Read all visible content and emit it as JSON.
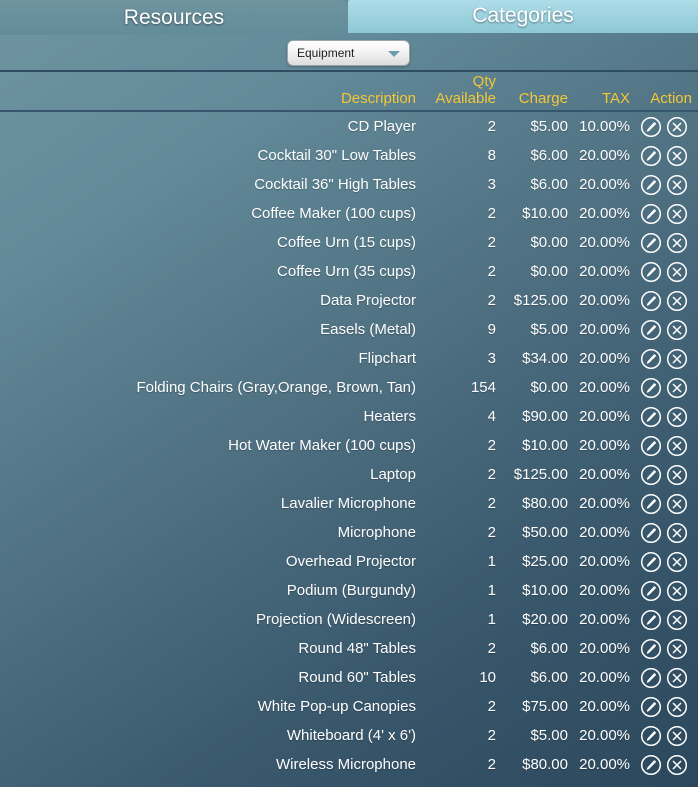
{
  "tabs": [
    {
      "label": "Resources",
      "active": true
    },
    {
      "label": "Categories",
      "active": false
    }
  ],
  "toolbar": {
    "category_select": {
      "value": "Equipment",
      "arrow_icon": "chevron-down-icon"
    }
  },
  "table": {
    "columns": [
      {
        "key": "description",
        "label": "Description"
      },
      {
        "key": "qty",
        "label": "Qty Available"
      },
      {
        "key": "charge",
        "label": "Charge"
      },
      {
        "key": "tax",
        "label": "TAX"
      },
      {
        "key": "action",
        "label": "Action"
      }
    ],
    "action_icons": {
      "edit": "pencil-icon",
      "delete": "close-circle-icon"
    },
    "rows": [
      {
        "description": "CD Player",
        "qty": "2",
        "charge": "$5.00",
        "tax": "10.00%"
      },
      {
        "description": "Cocktail 30\" Low Tables",
        "qty": "8",
        "charge": "$6.00",
        "tax": "20.00%"
      },
      {
        "description": "Cocktail 36\" High Tables",
        "qty": "3",
        "charge": "$6.00",
        "tax": "20.00%"
      },
      {
        "description": "Coffee Maker (100 cups)",
        "qty": "2",
        "charge": "$10.00",
        "tax": "20.00%"
      },
      {
        "description": "Coffee Urn (15 cups)",
        "qty": "2",
        "charge": "$0.00",
        "tax": "20.00%"
      },
      {
        "description": "Coffee Urn (35 cups)",
        "qty": "2",
        "charge": "$0.00",
        "tax": "20.00%"
      },
      {
        "description": "Data Projector",
        "qty": "2",
        "charge": "$125.00",
        "tax": "20.00%"
      },
      {
        "description": "Easels (Metal)",
        "qty": "9",
        "charge": "$5.00",
        "tax": "20.00%"
      },
      {
        "description": "Flipchart",
        "qty": "3",
        "charge": "$34.00",
        "tax": "20.00%"
      },
      {
        "description": "Folding Chairs (Gray,Orange, Brown, Tan)",
        "qty": "154",
        "charge": "$0.00",
        "tax": "20.00%"
      },
      {
        "description": "Heaters",
        "qty": "4",
        "charge": "$90.00",
        "tax": "20.00%"
      },
      {
        "description": "Hot Water Maker (100 cups)",
        "qty": "2",
        "charge": "$10.00",
        "tax": "20.00%"
      },
      {
        "description": "Laptop",
        "qty": "2",
        "charge": "$125.00",
        "tax": "20.00%"
      },
      {
        "description": "Lavalier Microphone",
        "qty": "2",
        "charge": "$80.00",
        "tax": "20.00%"
      },
      {
        "description": "Microphone",
        "qty": "2",
        "charge": "$50.00",
        "tax": "20.00%"
      },
      {
        "description": "Overhead Projector",
        "qty": "1",
        "charge": "$25.00",
        "tax": "20.00%"
      },
      {
        "description": "Podium (Burgundy)",
        "qty": "1",
        "charge": "$10.00",
        "tax": "20.00%"
      },
      {
        "description": "Projection (Widescreen)",
        "qty": "1",
        "charge": "$20.00",
        "tax": "20.00%"
      },
      {
        "description": "Round 48\" Tables",
        "qty": "2",
        "charge": "$6.00",
        "tax": "20.00%"
      },
      {
        "description": "Round 60\" Tables",
        "qty": "10",
        "charge": "$6.00",
        "tax": "20.00%"
      },
      {
        "description": "White Pop-up Canopies",
        "qty": "2",
        "charge": "$75.00",
        "tax": "20.00%"
      },
      {
        "description": "Whiteboard (4' x 6')",
        "qty": "2",
        "charge": "$5.00",
        "tax": "20.00%"
      },
      {
        "description": "Wireless Microphone",
        "qty": "2",
        "charge": "$80.00",
        "tax": "20.00%"
      }
    ]
  },
  "colors": {
    "header_text": "#f5c636",
    "tab_active_bg": "#628c99",
    "tab_inactive_bg": "#8ec8d6",
    "background_top": "#6e94a0",
    "background_bottom": "#2b475c",
    "border": "#2e4d63"
  }
}
